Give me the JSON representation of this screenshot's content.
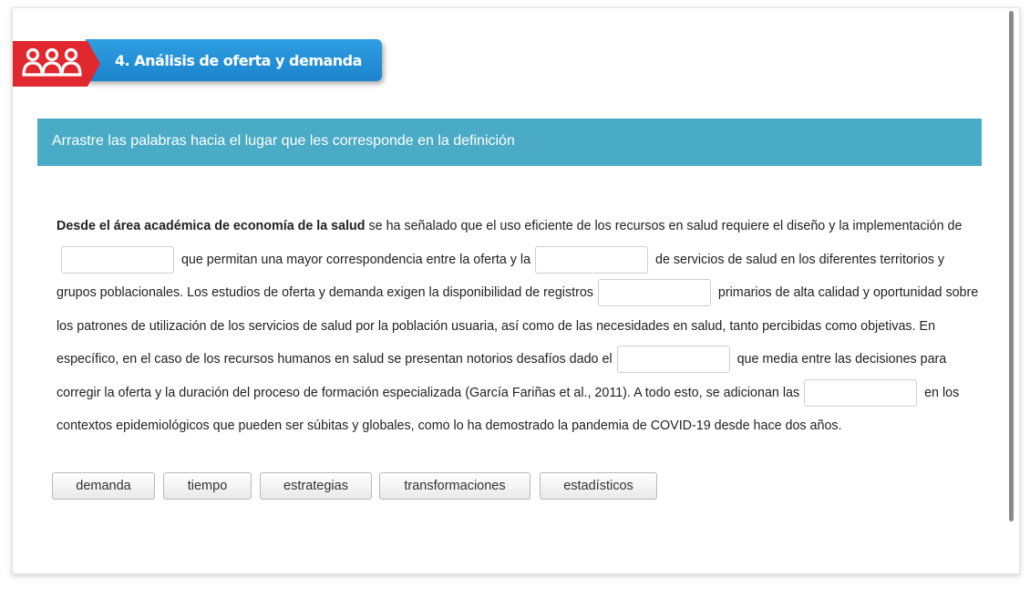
{
  "header": {
    "title": "4. Análisis de oferta y demanda",
    "icon": "people-group-icon"
  },
  "instruction": "Arrastre las palabras hacia el lugar que les corresponde en la definición",
  "paragraph": {
    "bold_lead": "Desde el área académica de economía de la salud",
    "seg1": " se ha señalado que el uso eficiente de los recursos en salud requiere el diseño y la implementación de",
    "seg2": " que permitan una mayor correspondencia entre la oferta y la",
    "seg3": " de servicios de salud en los diferentes territorios y grupos poblacionales. Los estudios de oferta y demanda exigen la disponibilidad de registros",
    "seg4": " primarios de alta calidad y oportunidad sobre los patrones de utilización de los servicios de salud por la población usuaria, así como de las necesidades en salud, tanto percibidas como objetivas. En específico, en el caso de los recursos humanos en salud se presentan notorios desafíos dado el",
    "seg5": " que media entre las decisiones para corregir la oferta y la duración del proceso de formación especializada (García Fariñas et al., 2011). A todo esto, se adicionan las",
    "seg6": " en los contextos epidemiológicos que pueden ser súbitas y globales, como lo ha demostrado la pandemia de COVID-19 desde hace dos años."
  },
  "word_bank": [
    "demanda",
    "tiempo",
    "estrategias",
    "transformaciones",
    "estadísticos"
  ],
  "colors": {
    "accent_blue": "#1b84cc",
    "banner": "#4aabc7",
    "badge_red": "#e0282e"
  }
}
